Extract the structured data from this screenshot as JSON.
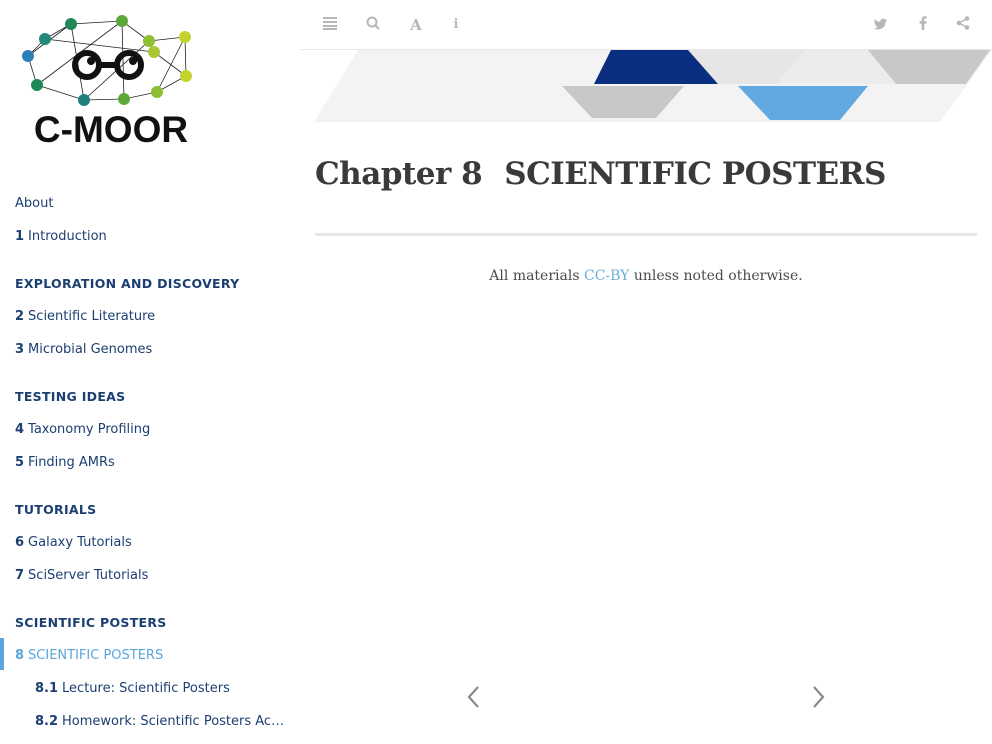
{
  "logo": {
    "text": "C-MOOR"
  },
  "toolbar": {
    "left_icons": [
      "menu-icon",
      "search-icon",
      "font-icon",
      "info-icon"
    ],
    "right_icons": [
      "twitter-icon",
      "facebook-icon",
      "share-icon"
    ]
  },
  "sidebar": {
    "about": "About",
    "items": [
      {
        "num": "1",
        "label": "Introduction"
      },
      {
        "header": "EXPLORATION AND DISCOVERY"
      },
      {
        "num": "2",
        "label": "Scientific Literature"
      },
      {
        "num": "3",
        "label": "Microbial Genomes"
      },
      {
        "header": "TESTING IDEAS"
      },
      {
        "num": "4",
        "label": "Taxonomy Profiling"
      },
      {
        "num": "5",
        "label": "Finding AMRs"
      },
      {
        "header": "TUTORIALS"
      },
      {
        "num": "6",
        "label": "Galaxy Tutorials"
      },
      {
        "num": "7",
        "label": "SciServer Tutorials"
      },
      {
        "header": "SCIENTIFIC POSTERS"
      },
      {
        "num": "8",
        "label": "SCIENTIFIC POSTERS"
      },
      {
        "num": "8.1",
        "label": "Lecture: Scientific Posters"
      },
      {
        "num": "8.2",
        "label": "Homework: Scientific Posters Acti..."
      }
    ]
  },
  "main": {
    "chapter_label": "Chapter 8",
    "chapter_title": "SCIENTIFIC POSTERS",
    "license_prefix": "All materials ",
    "license_link": "CC-BY",
    "license_suffix": " unless noted otherwise."
  },
  "colors": {
    "nav_text": "#1c3f72",
    "active": "#5aa6dc",
    "banner_dark": "#0a2f80",
    "banner_light": "#62a9e2",
    "banner_grey": "#c8c8c8"
  }
}
